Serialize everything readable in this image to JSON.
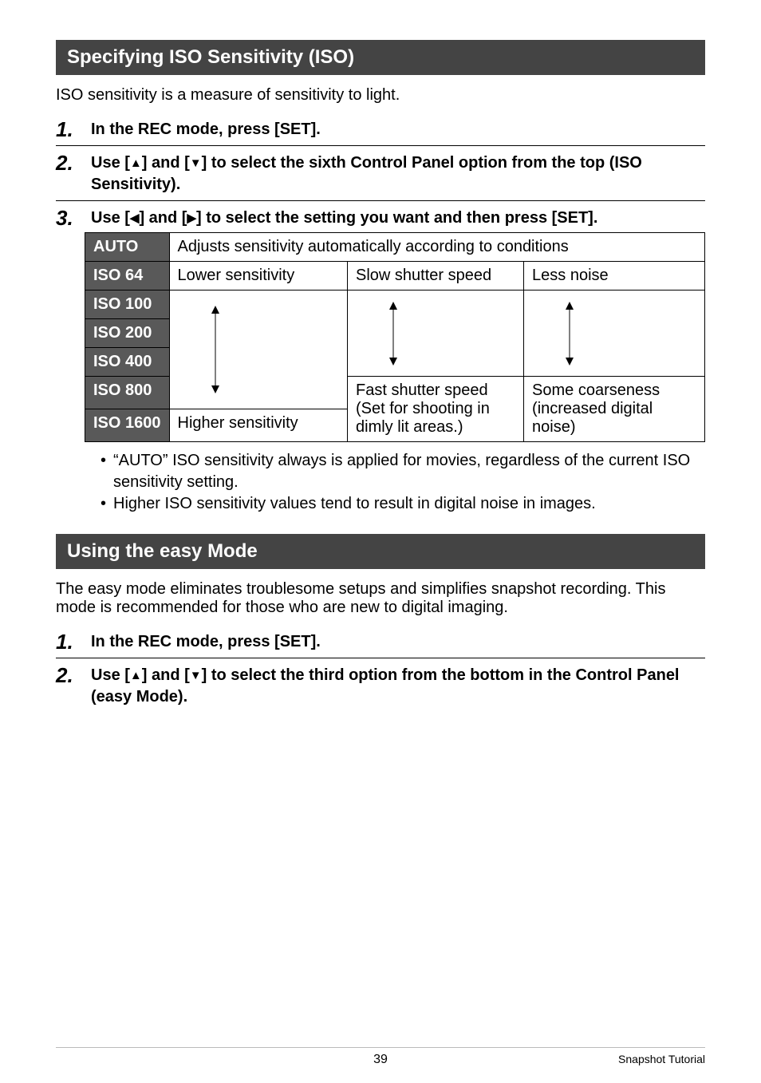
{
  "section1": {
    "title": "Specifying ISO Sensitivity (ISO)",
    "intro": "ISO sensitivity is a measure of sensitivity to light.",
    "steps": [
      {
        "num": "1.",
        "text": "In the REC mode, press [SET]."
      },
      {
        "num": "2.",
        "pre": "Use [",
        "mid1": "] and [",
        "mid2": "] to select the sixth Control Panel option from the top (ISO Sensitivity)."
      },
      {
        "num": "3.",
        "pre": "Use [",
        "mid1": "] and [",
        "mid2": "] to select the setting you want and then press [SET]."
      }
    ],
    "table": {
      "auto_label": "AUTO",
      "auto_desc": "Adjusts sensitivity automatically according to conditions",
      "iso64": "ISO 64",
      "iso100": "ISO 100",
      "iso200": "ISO 200",
      "iso400": "ISO 400",
      "iso800": "ISO 800",
      "iso1600": "ISO 1600",
      "col1_top": "Lower sensitivity",
      "col1_bot": "Higher sensitivity",
      "col2_top": "Slow shutter speed",
      "col2_bot": "Fast shutter speed (Set for shooting in dimly lit areas.)",
      "col3_top": "Less noise",
      "col3_bot": "Some coarseness (increased digital noise)"
    },
    "bullets": [
      "“AUTO” ISO sensitivity always is applied for movies, regardless of the current ISO sensitivity setting.",
      "Higher ISO sensitivity values tend to result in digital noise in images."
    ]
  },
  "section2": {
    "title": "Using the easy Mode",
    "intro": "The easy mode eliminates troublesome setups and simplifies snapshot recording. This mode is recommended for those who are new to digital imaging.",
    "steps": [
      {
        "num": "1.",
        "text": "In the REC mode, press [SET]."
      },
      {
        "num": "2.",
        "pre": "Use [",
        "mid1": "] and [",
        "mid2": "] to select the third option from the bottom in the Control Panel (easy Mode)."
      }
    ]
  },
  "footer": {
    "page": "39",
    "label": "Snapshot Tutorial"
  }
}
